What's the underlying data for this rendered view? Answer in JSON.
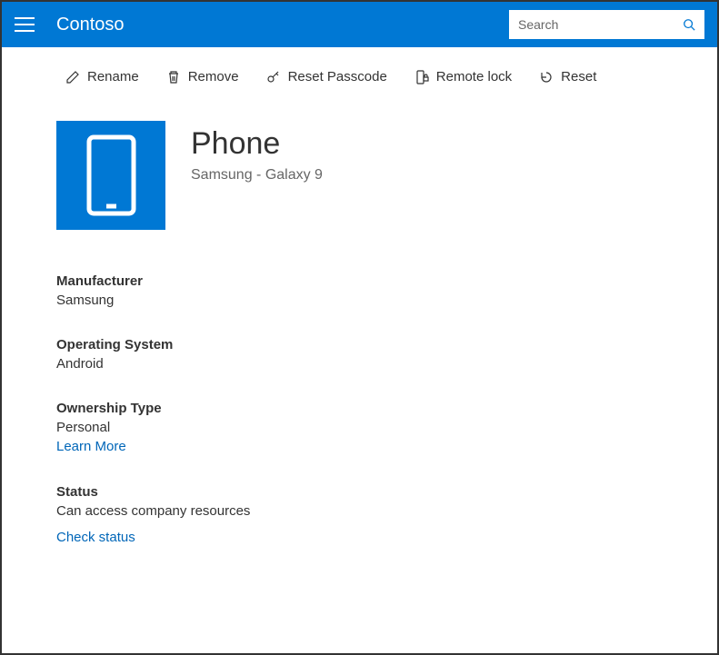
{
  "header": {
    "brand": "Contoso",
    "search_placeholder": "Search"
  },
  "toolbar": {
    "rename": "Rename",
    "remove": "Remove",
    "reset_passcode": "Reset Passcode",
    "remote_lock": "Remote lock",
    "reset": "Reset"
  },
  "device": {
    "title": "Phone",
    "subtitle": "Samsung - Galaxy 9"
  },
  "details": {
    "manufacturer": {
      "label": "Manufacturer",
      "value": "Samsung"
    },
    "os": {
      "label": "Operating System",
      "value": "Android"
    },
    "ownership": {
      "label": "Ownership Type",
      "value": "Personal",
      "link": "Learn More"
    },
    "status": {
      "label": "Status",
      "value": "Can access company resources",
      "action": "Check status"
    }
  }
}
